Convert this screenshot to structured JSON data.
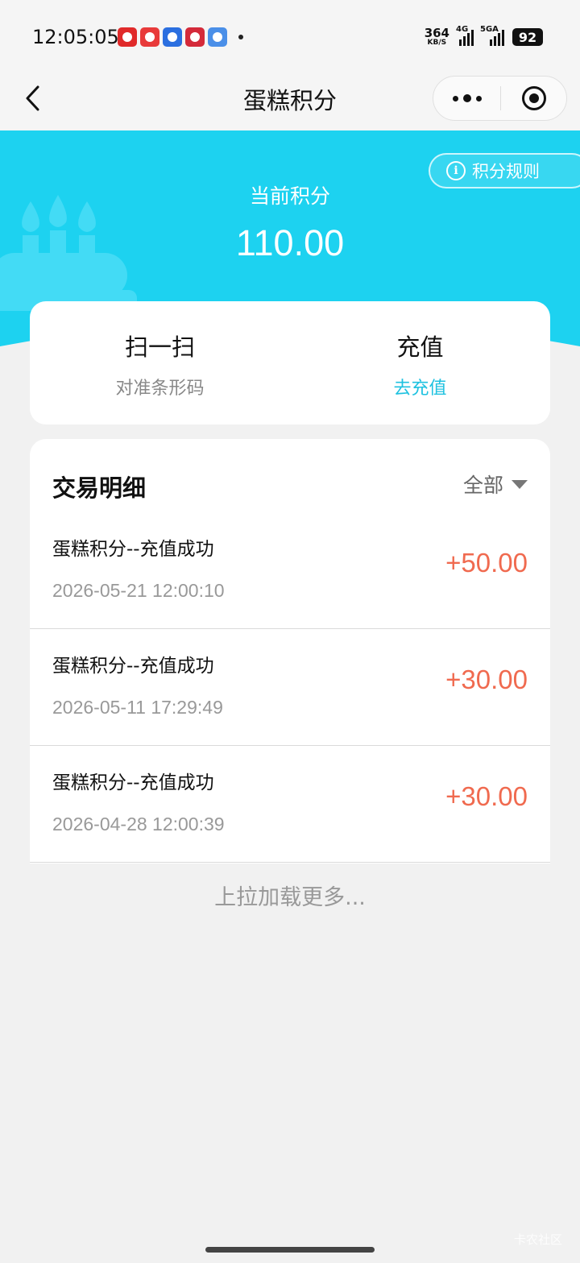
{
  "status_bar": {
    "time": "12:05:05",
    "net_speed": "364",
    "net_unit": "KB/S",
    "signal1_tag": "4G",
    "signal2_tag": "5GA",
    "battery": "92",
    "notification_colors": [
      "#e02a2a",
      "#e83a3a",
      "#2b6fe0",
      "#d42a3a",
      "#4a8fe8"
    ]
  },
  "nav": {
    "title": "蛋糕积分"
  },
  "header": {
    "rules_label": "积分规则",
    "points_label": "当前积分",
    "points_value": "110.00",
    "accent_color": "#1dd2f0"
  },
  "actions": {
    "scan": {
      "title": "扫一扫",
      "subtitle": "对准条形码"
    },
    "recharge": {
      "title": "充值",
      "subtitle": "去充值"
    }
  },
  "transactions": {
    "title": "交易明细",
    "filter": "全部",
    "items": [
      {
        "desc": "蛋糕积分--充值成功",
        "time": "2026-05-21 12:00:10",
        "amount": "+50.00"
      },
      {
        "desc": "蛋糕积分--充值成功",
        "time": "2026-05-11 17:29:49",
        "amount": "+30.00"
      },
      {
        "desc": "蛋糕积分--充值成功",
        "time": "2026-04-28 12:00:39",
        "amount": "+30.00"
      }
    ],
    "load_more": "上拉加载更多..."
  },
  "watermark": "卡农社区"
}
